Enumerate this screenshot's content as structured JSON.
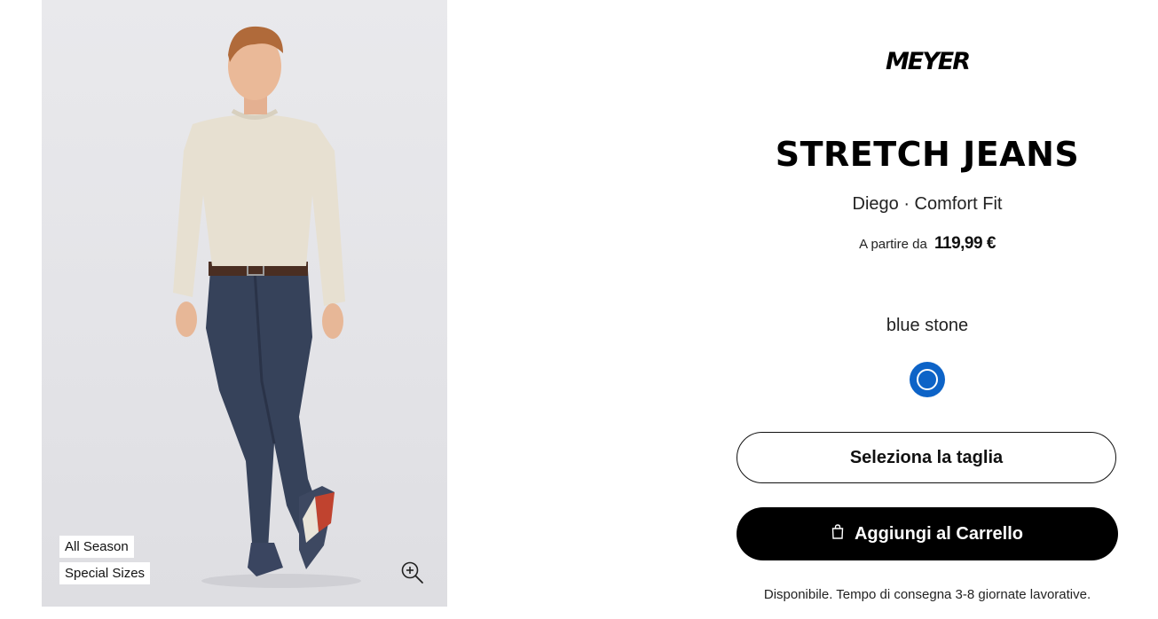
{
  "gallery": {
    "badges": [
      "All Season",
      "Special Sizes"
    ],
    "zoom_icon": "zoom-in-icon"
  },
  "product": {
    "brand": "MEYER",
    "title": "STRETCH JEANS",
    "subtitle": "Diego · Comfort Fit",
    "price_prefix": "A partire da",
    "price": "119,99 €",
    "color_name": "blue stone",
    "swatch_color": "#0d63c7"
  },
  "actions": {
    "size_label": "Seleziona la taglia",
    "cart_label": "Aggiungi al Carrello",
    "cart_icon": "shopping-bag-icon"
  },
  "availability": "Disponibile.  Tempo di consegna 3-8 giornate lavorative."
}
